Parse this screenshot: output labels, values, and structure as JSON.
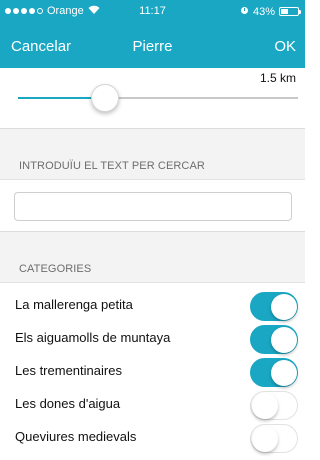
{
  "status_bar": {
    "carrier": "Orange",
    "time": "11:17",
    "battery": "43%",
    "battery_level": 0.43
  },
  "navbar": {
    "left": "Cancelar",
    "title": "Pierre",
    "right": "OK"
  },
  "distance": {
    "value": "1.5 km",
    "slider_fraction": 0.31,
    "accent": "#1aa7c3"
  },
  "search": {
    "section_title": "INTRODUÏU EL TEXT PER CERCAR",
    "value": "",
    "placeholder": ""
  },
  "categories": {
    "section_title": "CATEGORIES",
    "items": [
      {
        "label": "La mallerenga petita",
        "on": true
      },
      {
        "label": "Els aiguamolls de muntaya",
        "on": true
      },
      {
        "label": "Les trementinaires",
        "on": true
      },
      {
        "label": "Les dones d'aigua",
        "on": false
      },
      {
        "label": "Queviures medievals",
        "on": false
      }
    ]
  },
  "icons": [
    "wifi-icon",
    "alarm-icon",
    "battery-icon",
    "signal-dots-icon"
  ]
}
